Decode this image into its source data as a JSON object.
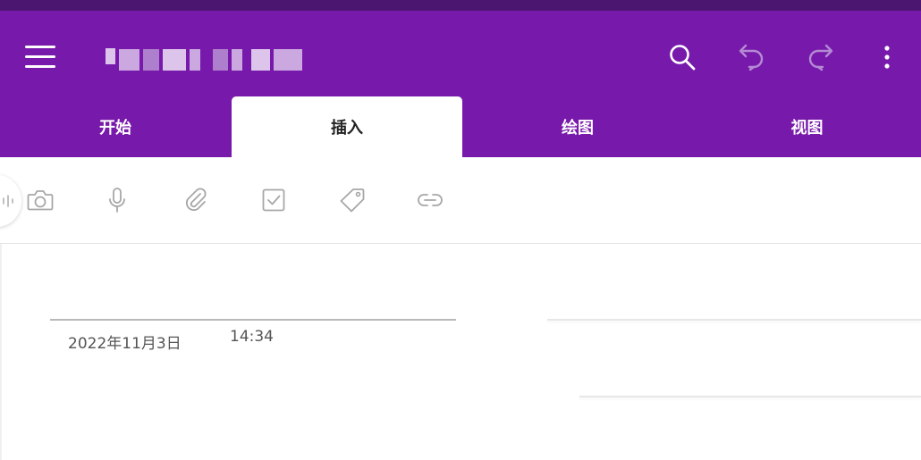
{
  "colors": {
    "header": "#7719aa",
    "top_strip": "#4a1670",
    "icon_gray": "#a7a7a7",
    "text_gray": "#555555"
  },
  "header": {
    "title_obscured": true,
    "icons": {
      "menu": "hamburger-menu-icon",
      "search": "search-icon",
      "undo": "undo-icon",
      "redo": "redo-icon",
      "more": "more-vertical-icon"
    }
  },
  "tabs": [
    {
      "label": "开始",
      "active": false
    },
    {
      "label": "插入",
      "active": true
    },
    {
      "label": "绘图",
      "active": false
    },
    {
      "label": "视图",
      "active": false
    }
  ],
  "toolbar": {
    "tools": [
      {
        "name": "camera-icon"
      },
      {
        "name": "microphone-icon"
      },
      {
        "name": "paperclip-icon"
      },
      {
        "name": "checkbox-icon"
      },
      {
        "name": "tag-icon"
      },
      {
        "name": "link-icon"
      }
    ]
  },
  "page": {
    "date": "2022年11月3日",
    "time": "14:34"
  }
}
